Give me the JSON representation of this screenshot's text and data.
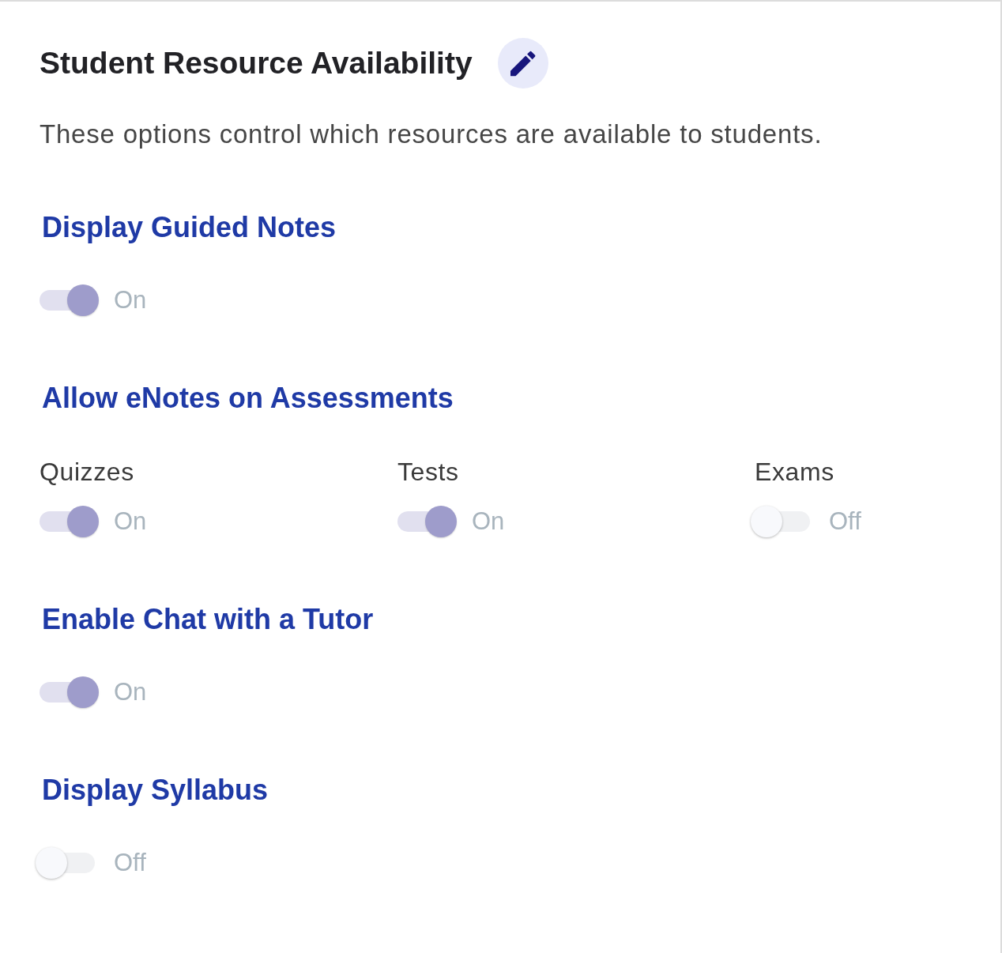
{
  "section": {
    "title": "Student Resource Availability",
    "description": "These options control which resources are available to students."
  },
  "settings": [
    {
      "kind": "single",
      "heading": "Display Guided Notes",
      "toggle": {
        "on": true,
        "disabled": true,
        "state_label": "On"
      }
    },
    {
      "kind": "group",
      "heading": "Allow eNotes on Assessments",
      "items": [
        {
          "label": "Quizzes",
          "on": true,
          "disabled": true,
          "state_label": "On"
        },
        {
          "label": "Tests",
          "on": true,
          "disabled": true,
          "state_label": "On"
        },
        {
          "label": "Exams",
          "on": false,
          "disabled": true,
          "state_label": "Off"
        }
      ]
    },
    {
      "kind": "single",
      "heading": "Enable Chat with a Tutor",
      "toggle": {
        "on": true,
        "disabled": true,
        "state_label": "On"
      }
    },
    {
      "kind": "single",
      "heading": "Display Syllabus",
      "toggle": {
        "on": false,
        "disabled": true,
        "state_label": "Off"
      }
    }
  ]
}
